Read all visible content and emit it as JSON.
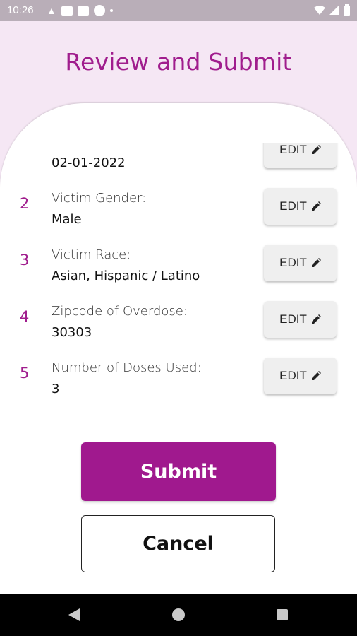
{
  "status_bar": {
    "time": "10:26",
    "icons": [
      "alert-icon",
      "mail-icon",
      "mail-icon",
      "parking-icon",
      "dot-icon",
      "wifi-icon",
      "signal-icon",
      "battery-icon"
    ]
  },
  "page_title": "Review and Submit",
  "items": [
    {
      "number": "",
      "label": "",
      "value": "02-01-2022",
      "edit_label": "EDIT"
    },
    {
      "number": "2",
      "label": "Victim Gender:",
      "value": "Male",
      "edit_label": "EDIT"
    },
    {
      "number": "3",
      "label": "Victim Race:",
      "value": "Asian, Hispanic / Latino",
      "edit_label": "EDIT"
    },
    {
      "number": "4",
      "label": "Zipcode of Overdose:",
      "value": "30303",
      "edit_label": "EDIT"
    },
    {
      "number": "5",
      "label": "Number of Doses Used:",
      "value": "3",
      "edit_label": "EDIT"
    }
  ],
  "submit_label": "Submit",
  "cancel_label": "Cancel",
  "colors": {
    "accent": "#a01d8d",
    "background": "#f5e7f4",
    "status_bar": "#b9aeb8"
  }
}
